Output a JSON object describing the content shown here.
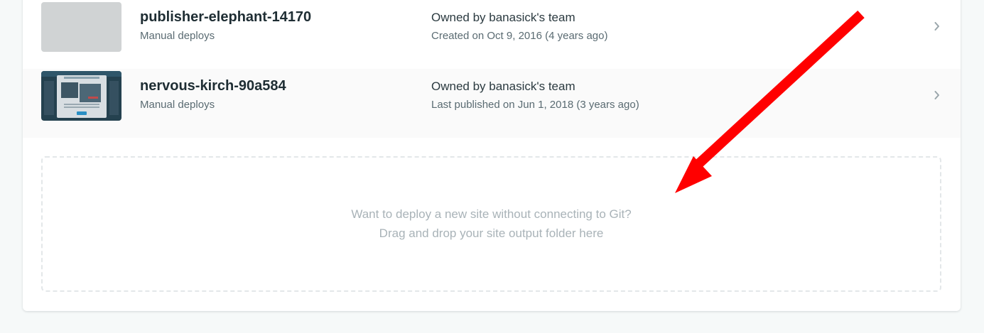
{
  "sites": [
    {
      "name": "publisher-elephant-14170",
      "deploy_type": "Manual deploys",
      "owner": "Owned by banasick's team",
      "meta": "Created on Oct 9, 2016 (4 years ago)",
      "thumbnail": "placeholder"
    },
    {
      "name": "nervous-kirch-90a584",
      "deploy_type": "Manual deploys",
      "owner": "Owned by banasick's team",
      "meta": "Last published on Jun 1, 2018 (3 years ago)",
      "thumbnail": "site-screenshot"
    }
  ],
  "dropzone": {
    "line1": "Want to deploy a new site without connecting to Git?",
    "line2": "Drag and drop your site output folder here"
  },
  "icons": {
    "row_chevron": "chevron-right-icon",
    "annotation": "red-arrow"
  },
  "colors": {
    "page_bg": "#f6f9f9",
    "card_bg": "#ffffff",
    "arrow": "#ff0000"
  }
}
